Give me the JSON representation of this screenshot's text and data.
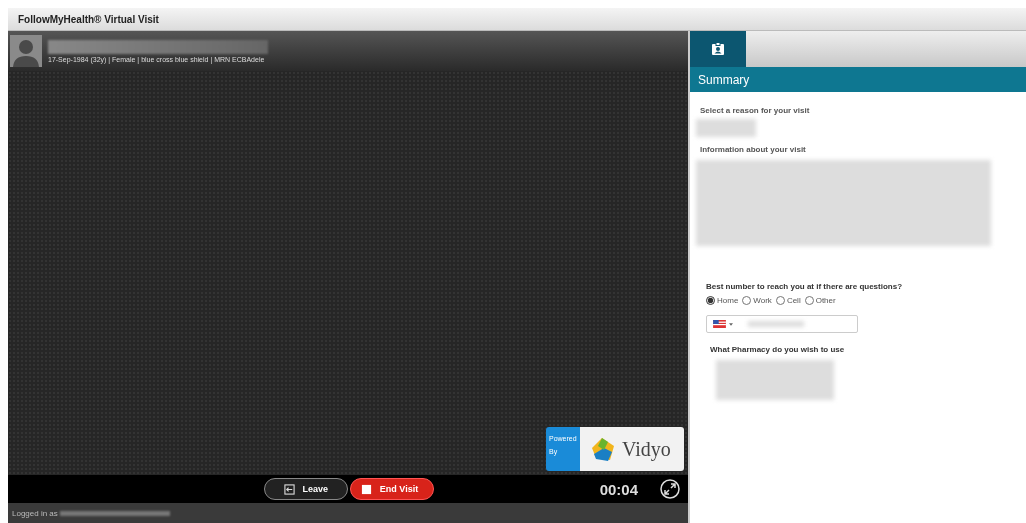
{
  "window": {
    "title": "FollowMyHealth® Virtual Visit"
  },
  "patient": {
    "details": "17-Sep-1984 (32y) | Female | blue cross blue shield | MRN ECBAdele"
  },
  "video": {
    "brand_prefix": "Powered By",
    "brand": "Vidyo"
  },
  "controls": [
    {
      "label": "Leave",
      "kind": "leave"
    },
    {
      "label": "End Visit",
      "kind": "end"
    }
  ],
  "timer": "00:04",
  "status_bar": {
    "text": "Logged in as"
  },
  "side_tabs": [
    {
      "selected": true
    }
  ],
  "panel": {
    "title": "Summary",
    "reason_label": "Select a reason for your visit",
    "info_label": "Information about your visit",
    "phone_question": "Best number to reach you at if there are questions?",
    "phone_options": [
      {
        "label": "Home",
        "selected": true
      },
      {
        "label": "Work",
        "selected": false
      },
      {
        "label": "Cell",
        "selected": false
      },
      {
        "label": "Other",
        "selected": false
      }
    ],
    "pharmacy_label": "What Pharmacy do you wish to use"
  }
}
